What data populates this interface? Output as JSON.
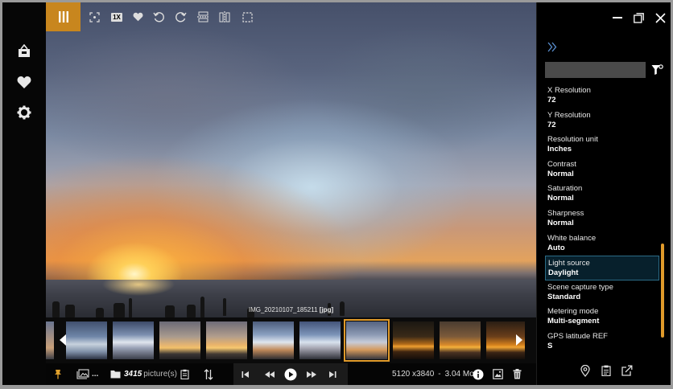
{
  "toolbar": {
    "zoom_label": "1X"
  },
  "photo": {
    "filename": "IMG_20210107_185211",
    "extension": "[jpg]"
  },
  "bottombar": {
    "picture_count": "3415",
    "picture_unit": "picture(s)",
    "folder_ellipsis": "...",
    "dimensions": "5120 x3840",
    "separator": "-",
    "filesize": "3.04 Mo"
  },
  "panel": {
    "search_placeholder": "",
    "properties": [
      {
        "label": "X Resolution",
        "value": "72"
      },
      {
        "label": "Y Resolution",
        "value": "72"
      },
      {
        "label": "Resolution unit",
        "value": "Inches"
      },
      {
        "label": "Contrast",
        "value": "Normal"
      },
      {
        "label": "Saturation",
        "value": "Normal"
      },
      {
        "label": "Sharpness",
        "value": "Normal"
      },
      {
        "label": "White balance",
        "value": "Auto"
      },
      {
        "label": "Light source",
        "value": "Daylight"
      },
      {
        "label": "Scene capture type",
        "value": "Standard"
      },
      {
        "label": "Metering mode",
        "value": "Multi-segment"
      },
      {
        "label": "GPS latitude REF",
        "value": "S"
      }
    ],
    "selected_property_index": 7
  },
  "icons": {
    "sidebar": [
      "folder-icon",
      "heart-icon",
      "gear-icon"
    ],
    "toolbar": [
      "columns-icon",
      "fit-icon",
      "zoom-1x-icon",
      "heart-icon",
      "rotate-left-icon",
      "rotate-right-icon",
      "flip-vertical-icon",
      "flip-horizontal-icon",
      "crop-icon"
    ]
  },
  "colors": {
    "accent": "#c8861e",
    "selection_border": "#2b6b86",
    "background": "#000000"
  }
}
